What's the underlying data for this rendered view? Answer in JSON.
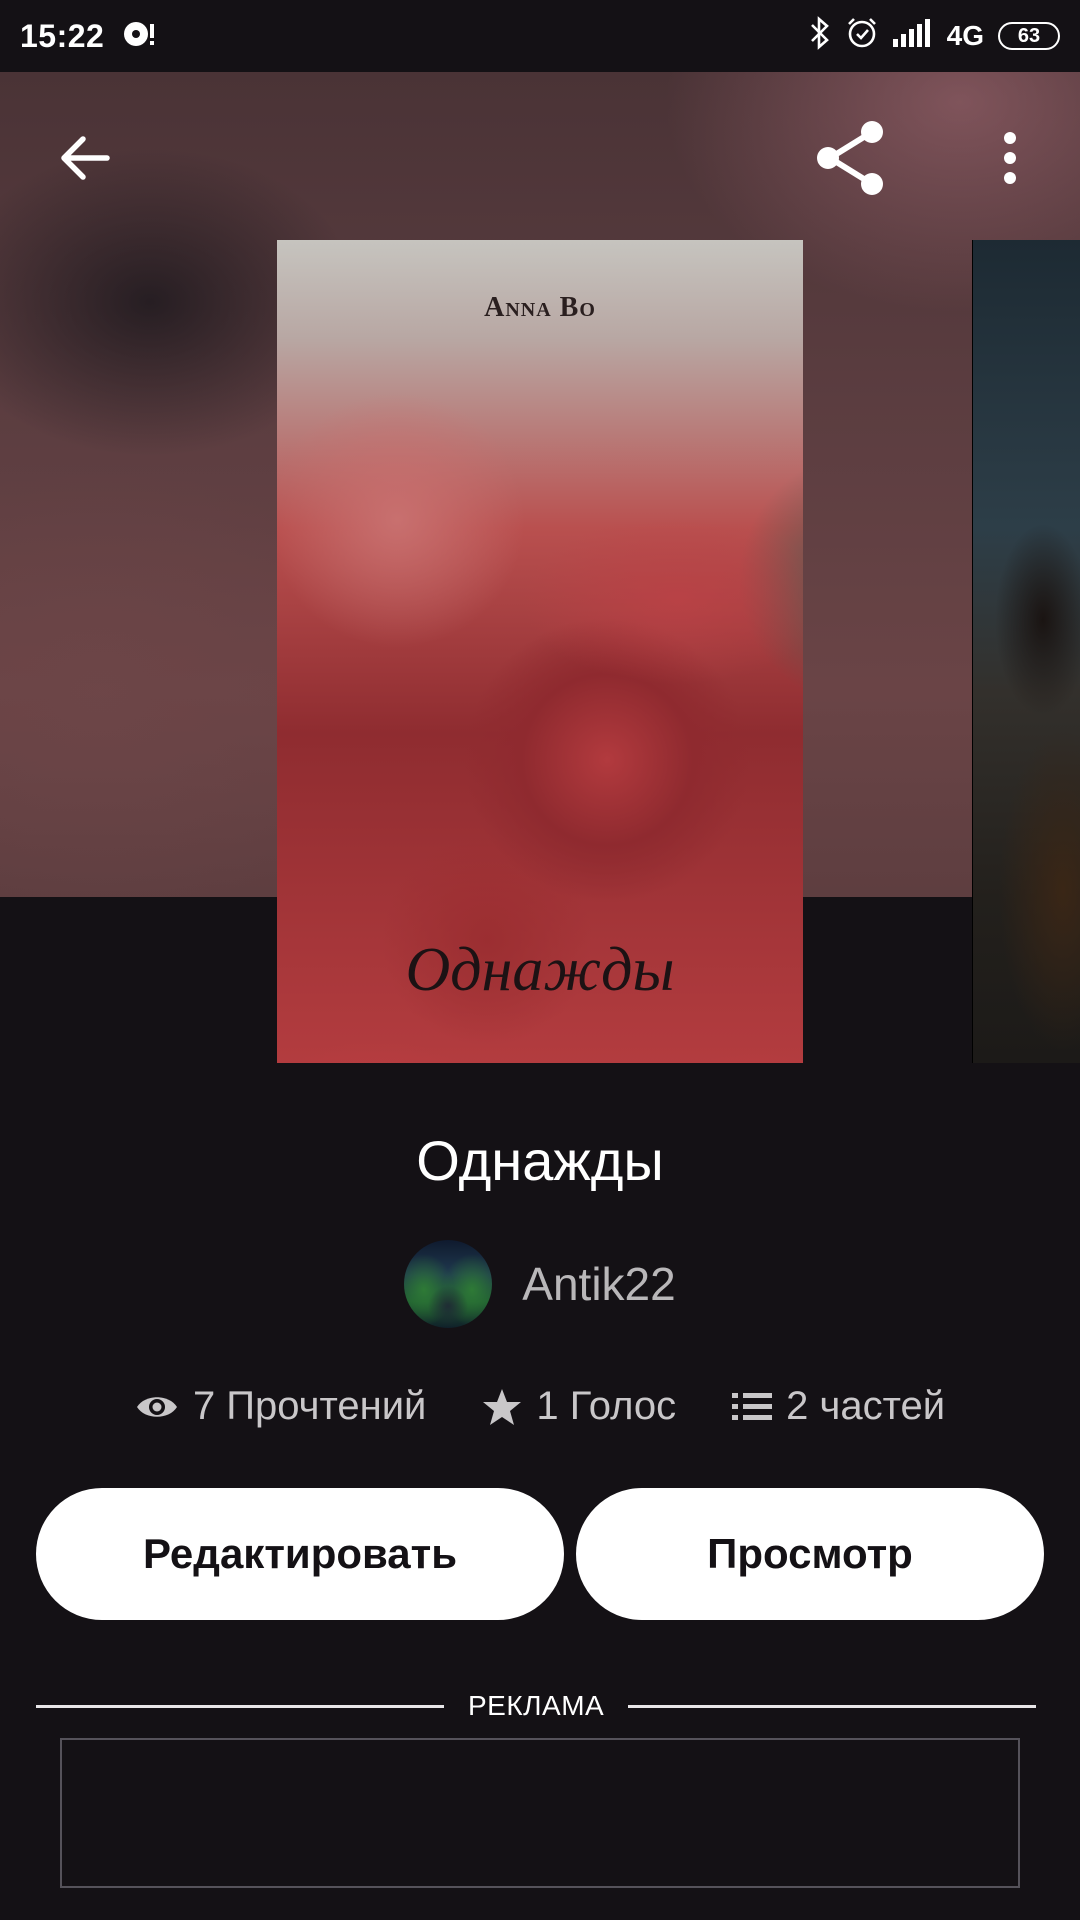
{
  "status_bar": {
    "time": "15:22",
    "network": "4G",
    "battery": "63"
  },
  "header": {
    "back_icon": "arrow-left-icon",
    "share_icon": "share-icon",
    "more_icon": "more-vertical-icon"
  },
  "cover": {
    "author": "Anna Bo",
    "title": "Однажды"
  },
  "book": {
    "title": "Однажды",
    "author": "Antik22",
    "stats": {
      "reads": "7 Прочтений",
      "votes": "1 Голос",
      "parts": "2 частей"
    }
  },
  "actions": {
    "edit_label": "Редактировать",
    "view_label": "Просмотр"
  },
  "ad": {
    "label": "РЕКЛАМА"
  },
  "colors": {
    "background": "#141115",
    "button_bg": "#ffffff",
    "button_text": "#141115",
    "muted_text": "#c9c7c9"
  }
}
